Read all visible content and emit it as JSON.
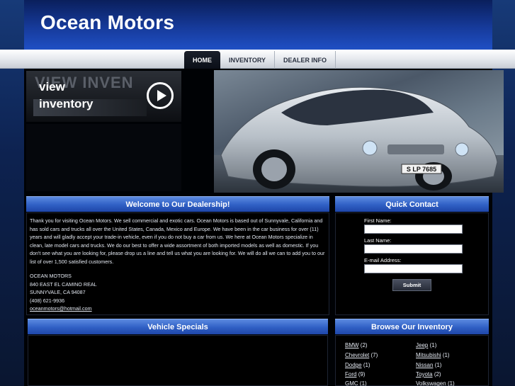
{
  "header": {
    "title": "Ocean Motors"
  },
  "nav": {
    "items": [
      {
        "label": "HOME"
      },
      {
        "label": "INVENTORY"
      },
      {
        "label": "DEALER INFO"
      }
    ]
  },
  "promo": {
    "ghost_text": "VIEW INVEN",
    "line1": "view",
    "line2": "inventory"
  },
  "welcome": {
    "title": "Welcome to Our Dealership!",
    "paragraph": "Thank you for visiting Ocean Motors.  We sell commercial and exotic cars. Ocean Motors is based out of Sunnyvale, California and has sold cars and trucks all over the United States, Canada, Mexico and Europe.  We have been in the car business for over (11) years and will gladly accept your trade-in vehicle, even if you do not buy a car from us.  We here at Ocean Motors specialize in clean, late model cars and trucks.  We do our best to offer a wide assortment of both imported models as well as domestic.  If you don't see what you are looking for, please drop us a line and tell us what you are looking for.  We will do all we can to add you to our list of over 1,500 satisfied customers.",
    "address": {
      "name": "OCEAN MOTORS",
      "street": "840 EAST EL CAMINO REAL",
      "city": "SUNNYVALE, CA 94087",
      "phone": "(408) 621-9936",
      "email": "oceanmotors@hotmail.com"
    }
  },
  "quick_contact": {
    "title": "Quick Contact",
    "first_name_label": "First Name:",
    "last_name_label": "Last Name:",
    "email_label": "E-mail Address:",
    "submit_label": "Submit"
  },
  "specials": {
    "title": "Vehicle Specials"
  },
  "browse": {
    "title": "Browse Our Inventory",
    "left": [
      {
        "make": "BMW",
        "count": "(2)"
      },
      {
        "make": "Chevrolet",
        "count": "(7)"
      },
      {
        "make": "Dodge",
        "count": "(1)"
      },
      {
        "make": "Ford",
        "count": "(9)"
      },
      {
        "make": "GMC",
        "count": "(1)"
      }
    ],
    "right": [
      {
        "make": "Jeep",
        "count": "(1)"
      },
      {
        "make": "Mitsubishi",
        "count": "(1)"
      },
      {
        "make": "Nissan",
        "count": "(1)"
      },
      {
        "make": "Toyota",
        "count": "(2)"
      },
      {
        "make": "Volkswagen",
        "count": "(1)"
      }
    ]
  },
  "hero": {
    "plate": "S LP 7685"
  }
}
